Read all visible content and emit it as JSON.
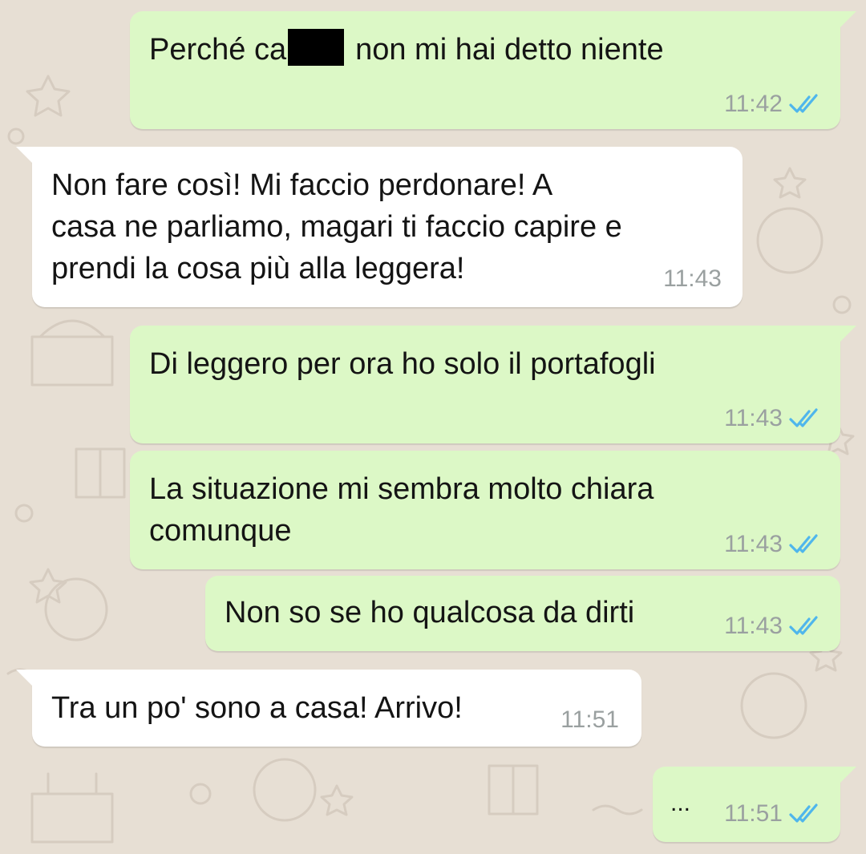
{
  "chat": {
    "messages": [
      {
        "direction": "outgoing",
        "text_before": "Perché ca",
        "redacted": true,
        "text_after": "non mi hai detto niente",
        "time": "11:42",
        "status": "read"
      },
      {
        "direction": "incoming",
        "lines": [
          "Non fare così! Mi faccio perdonare! A",
          "casa ne parliamo, magari ti faccio capire e",
          "prendi la cosa più alla leggera!"
        ],
        "time": "11:43"
      },
      {
        "direction": "outgoing",
        "lines": [
          "Di leggero per ora ho solo il portafogli"
        ],
        "time": "11:43",
        "status": "read"
      },
      {
        "direction": "outgoing",
        "lines": [
          "La situazione mi sembra molto chiara",
          "comunque"
        ],
        "time": "11:43",
        "status": "read"
      },
      {
        "direction": "outgoing",
        "lines": [
          "Non so se ho qualcosa da dirti"
        ],
        "time": "11:43",
        "status": "read"
      },
      {
        "direction": "incoming",
        "lines": [
          "Tra un po' sono a casa! Arrivo!"
        ],
        "time": "11:51"
      },
      {
        "direction": "outgoing",
        "lines": [
          "..."
        ],
        "time": "11:51",
        "status": "read"
      }
    ]
  },
  "icons": {
    "read_receipt": "double-check-icon",
    "wallpaper": "doodle-pattern"
  },
  "colors": {
    "background": "#e7dfd4",
    "outgoing_bubble": "#dcf8c6",
    "incoming_bubble": "#ffffff",
    "read_ticks": "#4fb6ec",
    "timestamp": "#9aa0a0",
    "text": "#141414"
  }
}
